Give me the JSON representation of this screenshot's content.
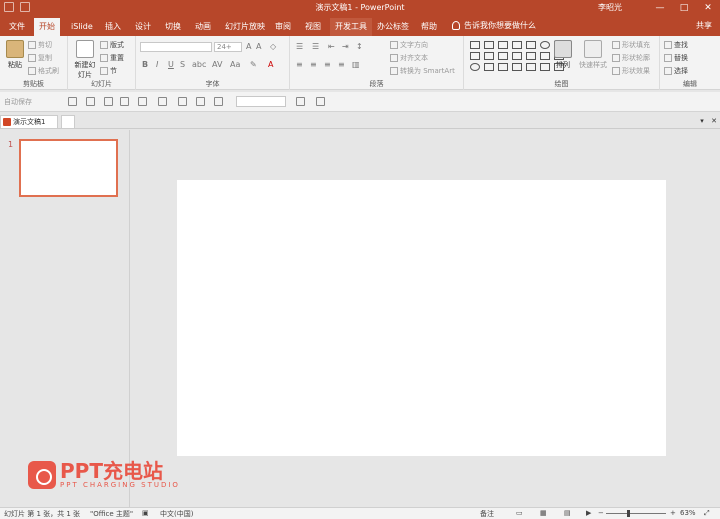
{
  "window": {
    "title": "演示文稿1 - PowerPoint",
    "user": "李昭光",
    "minimize": "—",
    "maximize": "□",
    "close": "✕"
  },
  "tabs": [
    {
      "label": "文件"
    },
    {
      "label": "开始"
    },
    {
      "label": "iSlide"
    },
    {
      "label": "插入"
    },
    {
      "label": "设计"
    },
    {
      "label": "切换"
    },
    {
      "label": "动画"
    },
    {
      "label": "幻灯片放映"
    },
    {
      "label": "审阅"
    },
    {
      "label": "视图"
    },
    {
      "label": "开发工具"
    },
    {
      "label": "办公标签"
    },
    {
      "label": "帮助"
    }
  ],
  "tell_me": "告诉我你想要做什么",
  "share": "共享",
  "ribbon": {
    "clipboard": {
      "label": "剪贴板",
      "paste": "粘贴",
      "cut": "剪切",
      "copy": "复制",
      "painter": "格式刷"
    },
    "slides": {
      "label": "幻灯片",
      "new_slide": "新建幻灯片",
      "layout": "版式",
      "reset": "重置",
      "section": "节"
    },
    "font": {
      "label": "字体",
      "font_name": "",
      "font_size": "24+"
    },
    "paragraph": {
      "label": "段落",
      "text_direction": "文字方向",
      "align_text": "对齐文本",
      "smartart": "转换为 SmartArt"
    },
    "drawing": {
      "label": "绘图",
      "arrange": "排列",
      "quick_styles": "快速样式",
      "fill": "形状填充",
      "outline": "形状轮廓",
      "effects": "形状效果"
    },
    "editing": {
      "label": "编辑",
      "find": "查找",
      "replace": "替换",
      "select": "选择"
    }
  },
  "qat2": {
    "label": "自动保存"
  },
  "doc_tab": {
    "label": "演示文稿1"
  },
  "slide_number": "1",
  "watermark": {
    "title": "PPT充电站",
    "subtitle": "PPT CHARGING STUDIO"
  },
  "status": {
    "slide_info": "幻灯片 第 1 张，共 1 张",
    "theme": "\"Office 主题\"",
    "language": "中文(中国)",
    "notes": "备注",
    "zoom": "63%"
  }
}
